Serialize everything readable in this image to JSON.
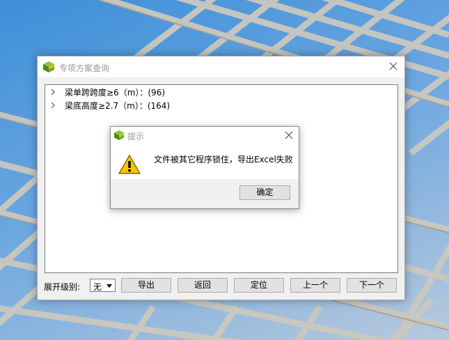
{
  "main_window": {
    "title": "专项方案查询",
    "tree_items": [
      {
        "label": "梁单跨跨度≥6（m）：(96)"
      },
      {
        "label": "梁底高度≥2.7（m）：(164)"
      }
    ],
    "expand_level_label": "展开级别:",
    "expand_level_value": "无",
    "buttons": {
      "export": "导出",
      "back": "返回",
      "locate": "定位",
      "prev": "上一个",
      "next": "下一个"
    }
  },
  "dialog": {
    "title": "提示",
    "message": "文件被其它程序锁住，导出Excel失败",
    "ok_label": "确定"
  },
  "colors": {
    "desktop_blue": "#3d8fd8",
    "beam_gray": "#c9c6bd",
    "warning_yellow": "#f5c400"
  }
}
